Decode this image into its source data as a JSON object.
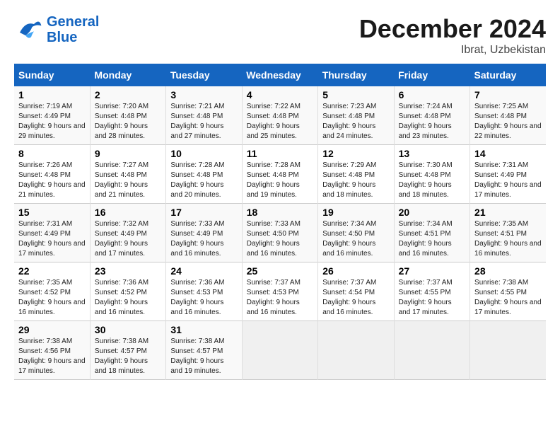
{
  "header": {
    "logo_line1": "General",
    "logo_line2": "Blue",
    "month": "December 2024",
    "location": "Ibrat, Uzbekistan"
  },
  "weekdays": [
    "Sunday",
    "Monday",
    "Tuesday",
    "Wednesday",
    "Thursday",
    "Friday",
    "Saturday"
  ],
  "weeks": [
    [
      {
        "day": "1",
        "sunrise": "7:19 AM",
        "sunset": "4:49 PM",
        "daylight": "9 hours and 29 minutes."
      },
      {
        "day": "2",
        "sunrise": "7:20 AM",
        "sunset": "4:48 PM",
        "daylight": "9 hours and 28 minutes."
      },
      {
        "day": "3",
        "sunrise": "7:21 AM",
        "sunset": "4:48 PM",
        "daylight": "9 hours and 27 minutes."
      },
      {
        "day": "4",
        "sunrise": "7:22 AM",
        "sunset": "4:48 PM",
        "daylight": "9 hours and 25 minutes."
      },
      {
        "day": "5",
        "sunrise": "7:23 AM",
        "sunset": "4:48 PM",
        "daylight": "9 hours and 24 minutes."
      },
      {
        "day": "6",
        "sunrise": "7:24 AM",
        "sunset": "4:48 PM",
        "daylight": "9 hours and 23 minutes."
      },
      {
        "day": "7",
        "sunrise": "7:25 AM",
        "sunset": "4:48 PM",
        "daylight": "9 hours and 22 minutes."
      }
    ],
    [
      {
        "day": "8",
        "sunrise": "7:26 AM",
        "sunset": "4:48 PM",
        "daylight": "9 hours and 21 minutes."
      },
      {
        "day": "9",
        "sunrise": "7:27 AM",
        "sunset": "4:48 PM",
        "daylight": "9 hours and 21 minutes."
      },
      {
        "day": "10",
        "sunrise": "7:28 AM",
        "sunset": "4:48 PM",
        "daylight": "9 hours and 20 minutes."
      },
      {
        "day": "11",
        "sunrise": "7:28 AM",
        "sunset": "4:48 PM",
        "daylight": "9 hours and 19 minutes."
      },
      {
        "day": "12",
        "sunrise": "7:29 AM",
        "sunset": "4:48 PM",
        "daylight": "9 hours and 18 minutes."
      },
      {
        "day": "13",
        "sunrise": "7:30 AM",
        "sunset": "4:48 PM",
        "daylight": "9 hours and 18 minutes."
      },
      {
        "day": "14",
        "sunrise": "7:31 AM",
        "sunset": "4:49 PM",
        "daylight": "9 hours and 17 minutes."
      }
    ],
    [
      {
        "day": "15",
        "sunrise": "7:31 AM",
        "sunset": "4:49 PM",
        "daylight": "9 hours and 17 minutes."
      },
      {
        "day": "16",
        "sunrise": "7:32 AM",
        "sunset": "4:49 PM",
        "daylight": "9 hours and 17 minutes."
      },
      {
        "day": "17",
        "sunrise": "7:33 AM",
        "sunset": "4:49 PM",
        "daylight": "9 hours and 16 minutes."
      },
      {
        "day": "18",
        "sunrise": "7:33 AM",
        "sunset": "4:50 PM",
        "daylight": "9 hours and 16 minutes."
      },
      {
        "day": "19",
        "sunrise": "7:34 AM",
        "sunset": "4:50 PM",
        "daylight": "9 hours and 16 minutes."
      },
      {
        "day": "20",
        "sunrise": "7:34 AM",
        "sunset": "4:51 PM",
        "daylight": "9 hours and 16 minutes."
      },
      {
        "day": "21",
        "sunrise": "7:35 AM",
        "sunset": "4:51 PM",
        "daylight": "9 hours and 16 minutes."
      }
    ],
    [
      {
        "day": "22",
        "sunrise": "7:35 AM",
        "sunset": "4:52 PM",
        "daylight": "9 hours and 16 minutes."
      },
      {
        "day": "23",
        "sunrise": "7:36 AM",
        "sunset": "4:52 PM",
        "daylight": "9 hours and 16 minutes."
      },
      {
        "day": "24",
        "sunrise": "7:36 AM",
        "sunset": "4:53 PM",
        "daylight": "9 hours and 16 minutes."
      },
      {
        "day": "25",
        "sunrise": "7:37 AM",
        "sunset": "4:53 PM",
        "daylight": "9 hours and 16 minutes."
      },
      {
        "day": "26",
        "sunrise": "7:37 AM",
        "sunset": "4:54 PM",
        "daylight": "9 hours and 16 minutes."
      },
      {
        "day": "27",
        "sunrise": "7:37 AM",
        "sunset": "4:55 PM",
        "daylight": "9 hours and 17 minutes."
      },
      {
        "day": "28",
        "sunrise": "7:38 AM",
        "sunset": "4:55 PM",
        "daylight": "9 hours and 17 minutes."
      }
    ],
    [
      {
        "day": "29",
        "sunrise": "7:38 AM",
        "sunset": "4:56 PM",
        "daylight": "9 hours and 17 minutes."
      },
      {
        "day": "30",
        "sunrise": "7:38 AM",
        "sunset": "4:57 PM",
        "daylight": "9 hours and 18 minutes."
      },
      {
        "day": "31",
        "sunrise": "7:38 AM",
        "sunset": "4:57 PM",
        "daylight": "9 hours and 19 minutes."
      },
      null,
      null,
      null,
      null
    ]
  ]
}
